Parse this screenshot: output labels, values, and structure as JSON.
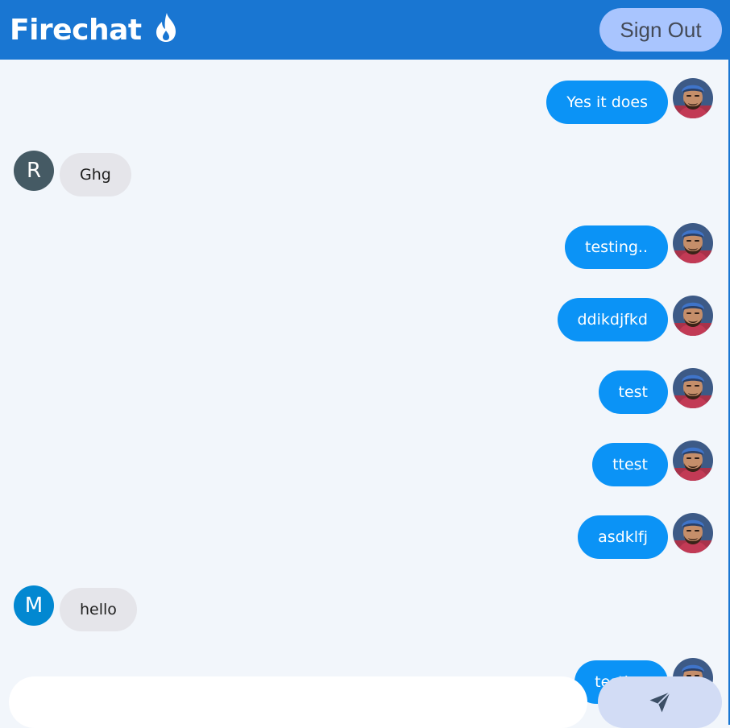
{
  "app": {
    "title": "Firechat",
    "logo_icon": "flame-icon"
  },
  "header": {
    "signout_label": "Sign Out"
  },
  "colors": {
    "header_bg": "#1976d2",
    "sent_bubble": "#0b93f6",
    "received_bubble": "#e5e5ea",
    "signout_bg": "#a9c5fe",
    "send_button_bg": "#d2dcf5"
  },
  "messages": [
    {
      "side": "sent",
      "text": "Yes it does",
      "avatar": "user-photo"
    },
    {
      "side": "received",
      "text": "Ghg",
      "avatar_letter": "R",
      "avatar_color": "#455a64"
    },
    {
      "side": "sent",
      "text": "testing..",
      "avatar": "user-photo"
    },
    {
      "side": "sent",
      "text": "ddikdjfkd",
      "avatar": "user-photo"
    },
    {
      "side": "sent",
      "text": "test",
      "avatar": "user-photo"
    },
    {
      "side": "sent",
      "text": "ttest",
      "avatar": "user-photo"
    },
    {
      "side": "sent",
      "text": "asdklfj",
      "avatar": "user-photo"
    },
    {
      "side": "received",
      "text": "hello",
      "avatar_letter": "M",
      "avatar_color": "#0288d1"
    },
    {
      "side": "sent",
      "text": "testing",
      "avatar": "user-photo"
    }
  ],
  "composer": {
    "input_value": "",
    "input_placeholder": "",
    "send_icon": "send-icon"
  }
}
